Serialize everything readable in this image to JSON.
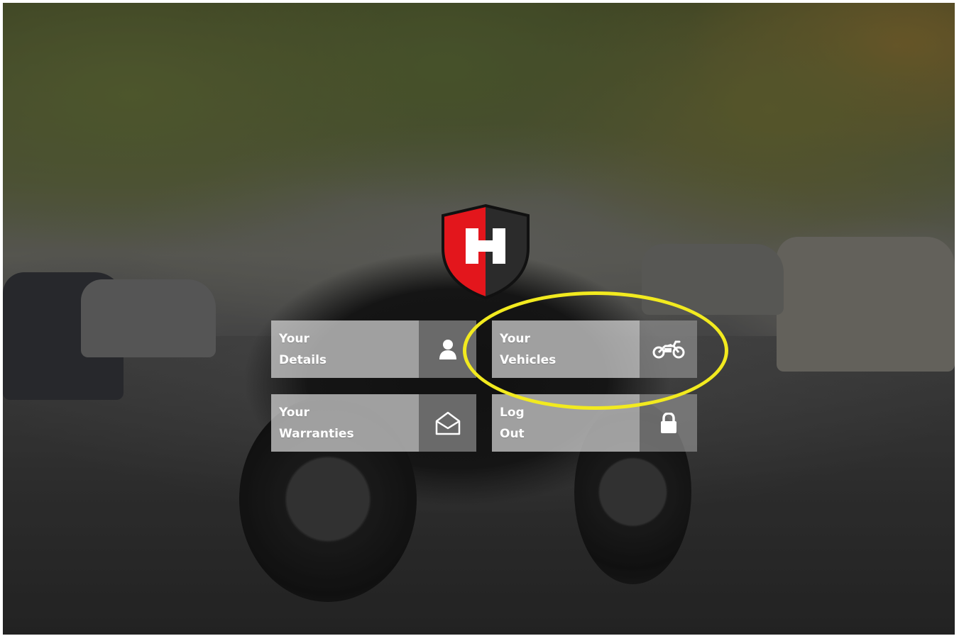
{
  "brand": {
    "logo_letter": "H",
    "logo_colors": {
      "left": "#e3161c",
      "right": "#2b2b2b",
      "border": "#1a1a1a",
      "letter": "#ffffff"
    }
  },
  "menu": {
    "tiles": [
      {
        "line1": "Your",
        "line2": "Details",
        "icon": "user-icon"
      },
      {
        "line1": "Your",
        "line2": "Vehicles",
        "icon": "motorbike-icon"
      },
      {
        "line1": "Your",
        "line2": "Warranties",
        "icon": "envelope-open-icon"
      },
      {
        "line1": "Log",
        "line2": "Out",
        "icon": "lock-icon"
      }
    ]
  },
  "annotation": {
    "highlighted_tile": "Your Vehicles",
    "highlight_color": "#f2ea1f"
  },
  "colors": {
    "tile_label_bg": "rgba(215,215,215,0.72)",
    "tile_icon_bg": "rgba(140,140,140,0.72)",
    "tile_text": "#ffffff"
  }
}
